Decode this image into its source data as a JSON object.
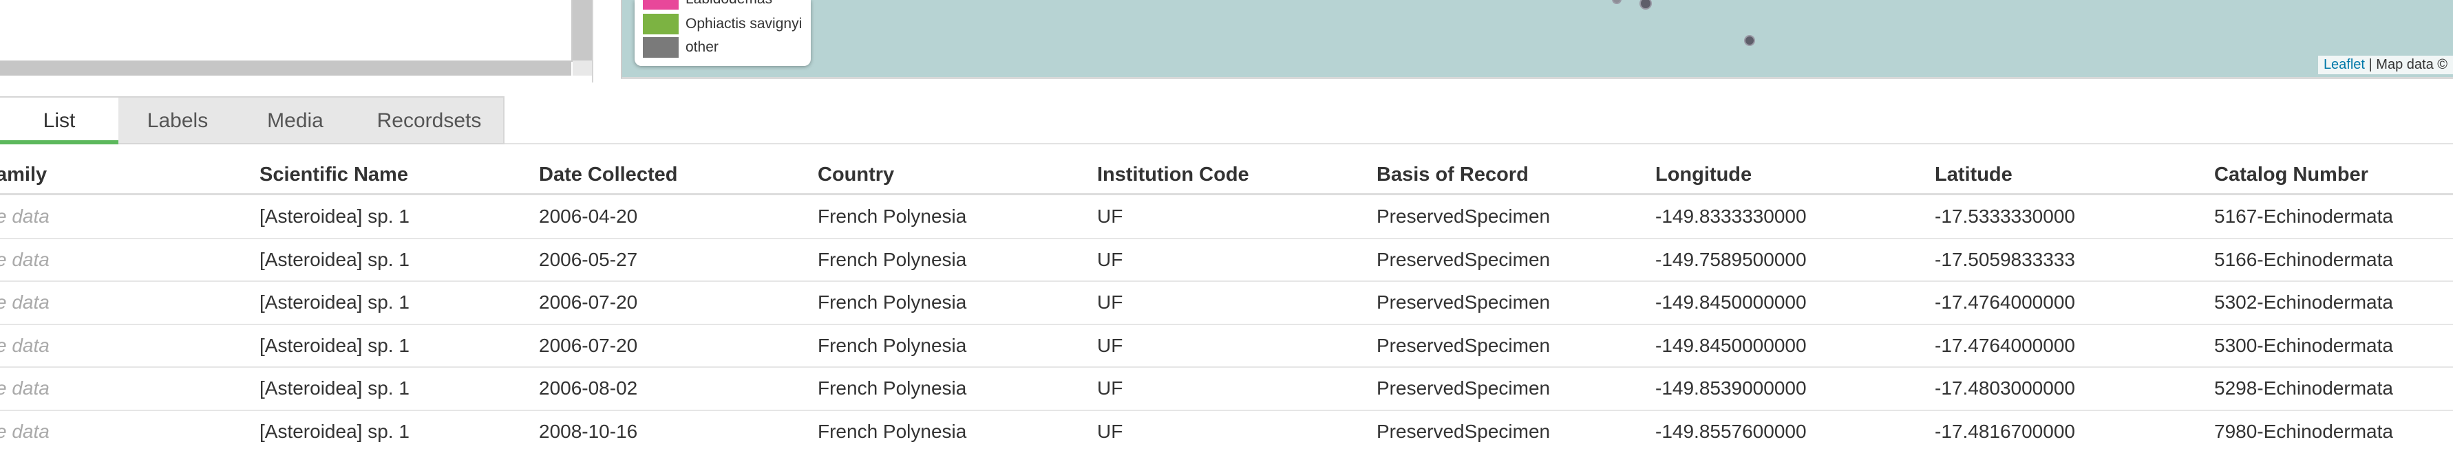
{
  "map": {
    "legend": [
      {
        "label": "Labidodemas",
        "color": "#e8479a"
      },
      {
        "label": "Ophiactis savignyi",
        "color": "#7cb342"
      },
      {
        "label": "other",
        "color": "#7a7a7a"
      }
    ],
    "attribution_link": "Leaflet",
    "attribution_text": " | Map data ©"
  },
  "tabs": [
    {
      "label": "List",
      "active": true
    },
    {
      "label": "Labels",
      "active": false
    },
    {
      "label": "Media",
      "active": false
    },
    {
      "label": "Recordsets",
      "active": false
    }
  ],
  "table": {
    "columns": [
      "amily",
      "Scientific Name",
      "Date Collected",
      "Country",
      "Institution Code",
      "Basis of Record",
      "Longitude",
      "Latitude",
      "Catalog Number"
    ],
    "rows": [
      [
        "e data",
        "[Asteroidea] sp. 1",
        "2006-04-20",
        "French Polynesia",
        "UF",
        "PreservedSpecimen",
        "-149.8333330000",
        "-17.5333330000",
        "5167-Echinodermata"
      ],
      [
        "e data",
        "[Asteroidea] sp. 1",
        "2006-05-27",
        "French Polynesia",
        "UF",
        "PreservedSpecimen",
        "-149.7589500000",
        "-17.5059833333",
        "5166-Echinodermata"
      ],
      [
        "e data",
        "[Asteroidea] sp. 1",
        "2006-07-20",
        "French Polynesia",
        "UF",
        "PreservedSpecimen",
        "-149.8450000000",
        "-17.4764000000",
        "5302-Echinodermata"
      ],
      [
        "e data",
        "[Asteroidea] sp. 1",
        "2006-07-20",
        "French Polynesia",
        "UF",
        "PreservedSpecimen",
        "-149.8450000000",
        "-17.4764000000",
        "5300-Echinodermata"
      ],
      [
        "e data",
        "[Asteroidea] sp. 1",
        "2006-08-02",
        "French Polynesia",
        "UF",
        "PreservedSpecimen",
        "-149.8539000000",
        "-17.4803000000",
        "5298-Echinodermata"
      ],
      [
        "e data",
        "[Asteroidea] sp. 1",
        "2008-10-16",
        "French Polynesia",
        "UF",
        "PreservedSpecimen",
        "-149.8557600000",
        "-17.4816700000",
        "7980-Echinodermata"
      ]
    ]
  }
}
